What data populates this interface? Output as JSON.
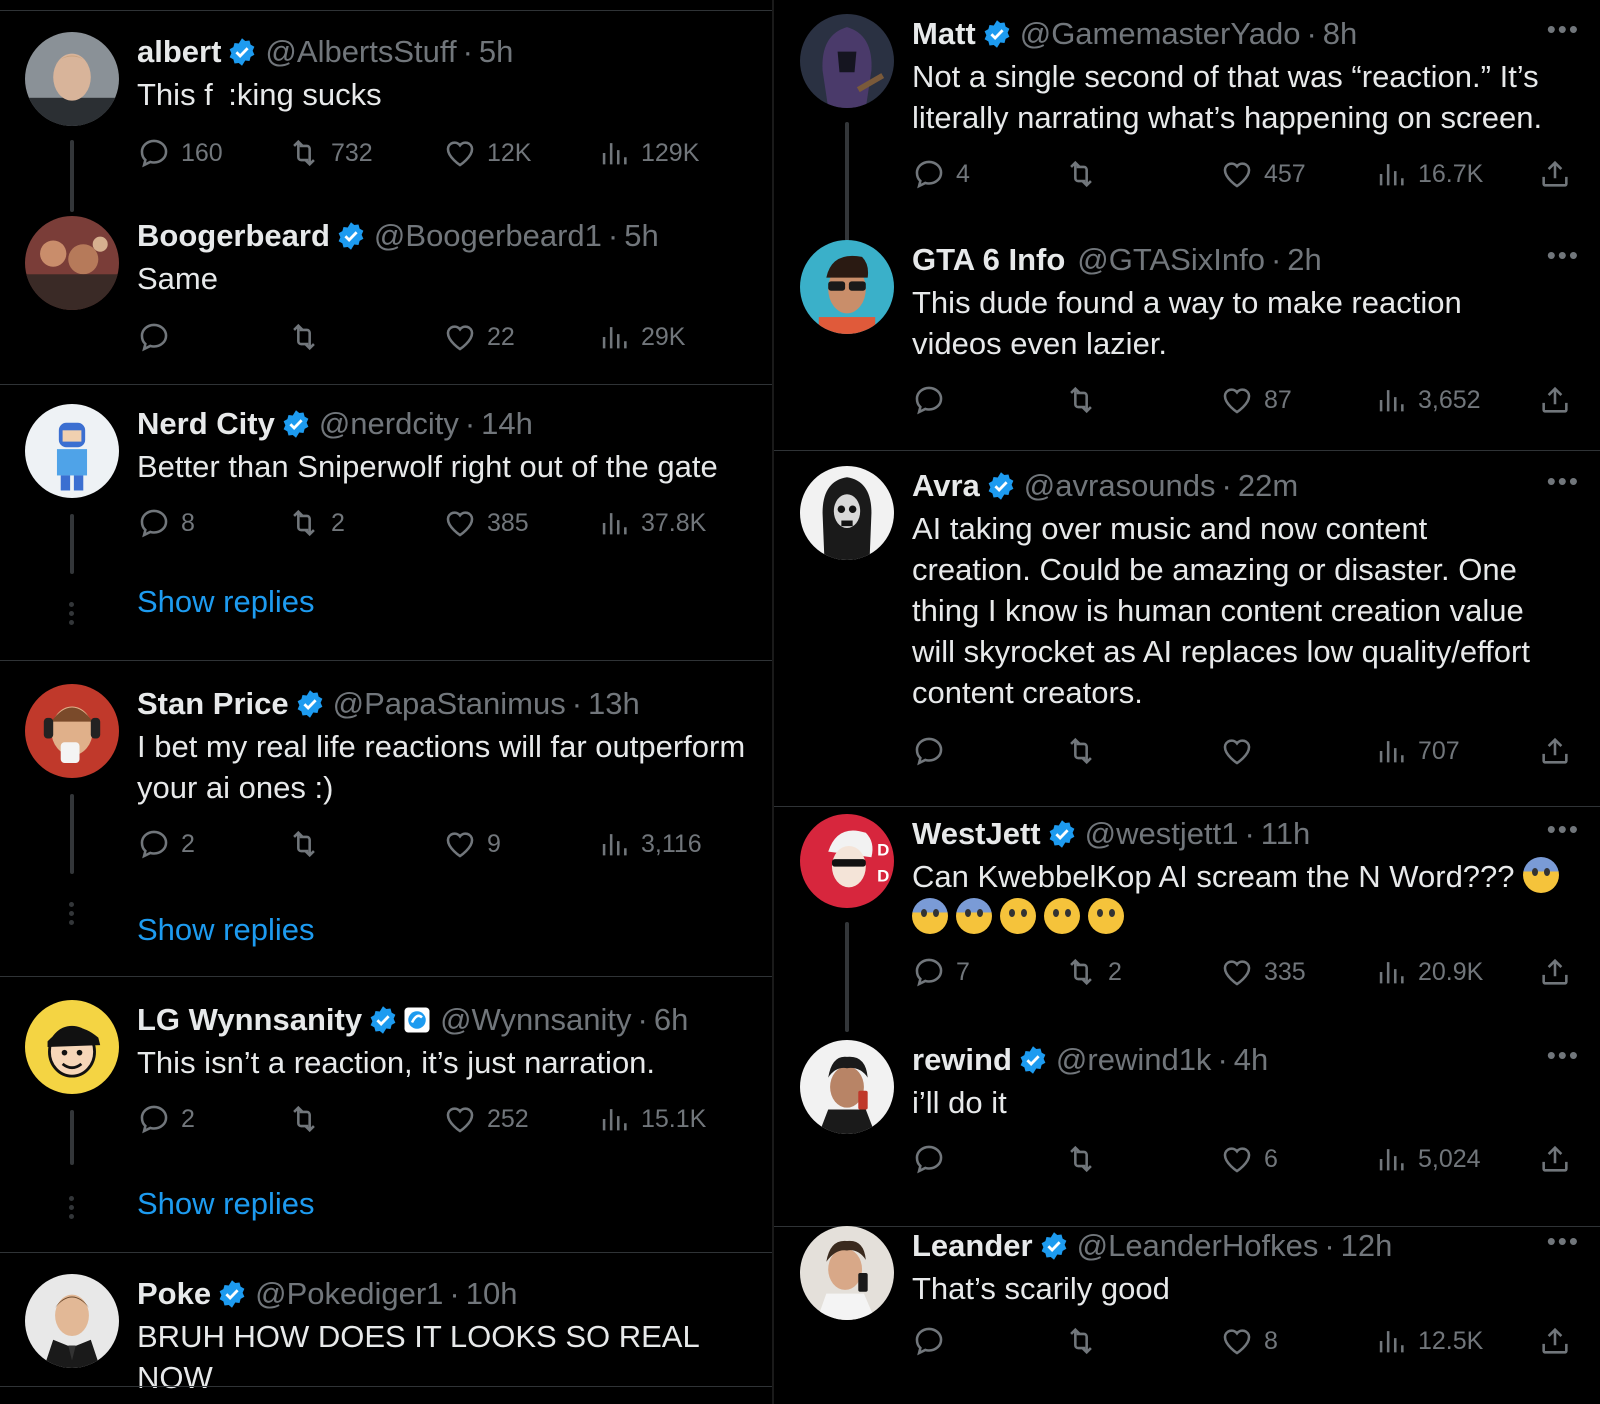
{
  "left": [
    {
      "name": "albert",
      "handle": "@AlbertsStuff",
      "time": "5h",
      "text": "This f :king sucks",
      "replies": "160",
      "retweets": "732",
      "likes": "12K",
      "views": "129K",
      "avatar": "person-light"
    },
    {
      "name": "Boogerbeard",
      "handle": "@Boogerbeard1",
      "time": "5h",
      "text": "Same",
      "replies": "",
      "retweets": "",
      "likes": "22",
      "views": "29K",
      "avatar": "crowd"
    },
    {
      "name": "Nerd City",
      "handle": "@nerdcity",
      "time": "14h",
      "text": "Better than Sniperwolf right out of the gate",
      "replies": "8",
      "retweets": "2",
      "likes": "385",
      "views": "37.8K",
      "avatar": "robot",
      "show_replies": "Show replies"
    },
    {
      "name": "Stan Price",
      "handle": "@PapaStanimus",
      "time": "13h",
      "text": "I bet my real life reactions will far outperform\nyour ai ones :)",
      "replies": "2",
      "retweets": "",
      "likes": "9",
      "views": "3,116",
      "avatar": "headset",
      "show_replies": "Show replies"
    },
    {
      "name": "LG Wynnsanity",
      "handle": "@Wynnsanity",
      "time": "6h",
      "text": "This isn’t a reaction, it’s just narration.",
      "replies": "2",
      "retweets": "",
      "likes": "252",
      "views": "15.1K",
      "avatar": "cartoon-yellow",
      "show_replies": "Show replies"
    },
    {
      "name": "Poke",
      "handle": "@Pokediger1",
      "time": "10h",
      "text": "BRUH HOW DOES IT LOOKS SO REAL NOW\nWTH",
      "avatar": "person-suit"
    }
  ],
  "right": [
    {
      "name": "Matt",
      "handle": "@GamemasterYado",
      "time": "8h",
      "text": "Not a single second of that was “reaction.” It’s\nliterally narrating what’s happening on screen.",
      "replies": "4",
      "retweets": "",
      "likes": "457",
      "views": "16.7K",
      "avatar": "hooded"
    },
    {
      "name": "GTA 6 Info",
      "handle": "@GTASixInfo",
      "time": "2h",
      "text": "This dude found a way to make reaction\nvideos even lazier.",
      "replies": "",
      "retweets": "",
      "likes": "87",
      "views": "3,652",
      "avatar": "sunglasses",
      "verified": false
    },
    {
      "name": "Avra",
      "handle": "@avrasounds",
      "time": "22m",
      "text": "AI taking over music and now content\ncreation. Could be amazing or disaster. One\nthing I know is human content creation value\nwill skyrocket as AI replaces low quality/effort\ncontent creators.",
      "replies": "",
      "retweets": "",
      "likes": "",
      "views": "707",
      "avatar": "skull-bw"
    },
    {
      "name": "WestJett",
      "handle": "@westjett1",
      "time": "11h",
      "text": "Can KwebbelKop AI scream the N Word???",
      "replies": "7",
      "retweets": "2",
      "likes": "335",
      "views": "20.9K",
      "avatar": "anime-red"
    },
    {
      "name": "rewind",
      "handle": "@rewind1k",
      "time": "4h",
      "text": "i’ll do it",
      "replies": "",
      "retweets": "",
      "likes": "6",
      "views": "5,024",
      "avatar": "person-curly"
    },
    {
      "name": "Leander",
      "handle": "@LeanderHofkes",
      "time": "12h",
      "text": "That’s scarily good",
      "replies": "",
      "retweets": "",
      "likes": "8",
      "views": "12.5K",
      "avatar": "person-phone"
    }
  ],
  "colors": {
    "background": "#000000",
    "text": "#e7e9ea",
    "secondary": "#71767b",
    "link": "#1d9bf0",
    "verified": "#1d9bf0"
  }
}
